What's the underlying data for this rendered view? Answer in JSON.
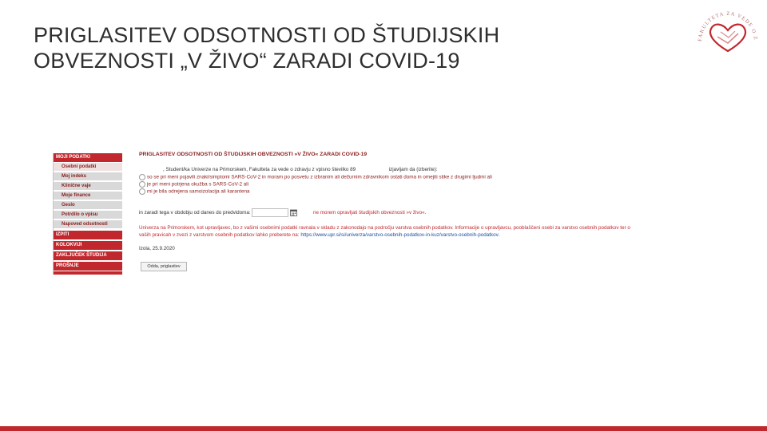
{
  "slide": {
    "title_line1": "PRIGLASITEV ODSOTNOSTI OD ŠTUDIJSKIH",
    "title_line2": "OBVEZNOSTI „V ŽIVO“ ZARADI COVID-19"
  },
  "logo": {
    "text": "FAKULTETA ZA VEDE O ZDRAVJU"
  },
  "colors": {
    "accent": "#c0282d",
    "sidebar_sub": "#d9d9d9",
    "link": "#1a4fa0"
  },
  "sidebar": {
    "items": [
      {
        "label": "MOJI PODATKI",
        "kind": "head"
      },
      {
        "label": "Osebni podatki",
        "kind": "sub"
      },
      {
        "label": "Moj indeks",
        "kind": "sub"
      },
      {
        "label": "Klinične vaje",
        "kind": "sub"
      },
      {
        "label": "Moje finance",
        "kind": "sub"
      },
      {
        "label": "Geslo",
        "kind": "sub"
      },
      {
        "label": "Potrdilo o vpisu",
        "kind": "sub"
      },
      {
        "label": "Napoved odsotnosti",
        "kind": "sub"
      },
      {
        "label": "IZPITI",
        "kind": "head"
      },
      {
        "label": "KOLOKVIJI",
        "kind": "head"
      },
      {
        "label": "ZAKLJUČEK ŠTUDIJA",
        "kind": "head"
      },
      {
        "label": "PROŠNJE",
        "kind": "head"
      }
    ]
  },
  "form": {
    "title": "PRIGLASITEV ODSOTNOSTI OD ŠTUDIJSKIH OBVEZNOSTI »V ŽIVO« ZARADI COVID-19",
    "intro_a": ", Student/ka Univerze na Primorskem, Fakulteta za vede o zdravju z vpisno številko 89",
    "intro_b": "izjavljam da (izberite):",
    "options": [
      "so se pri meni pojavili znaki/simptomi SARS-CoV-2 in moram po posvetu z izbranim ali dežurnim zdravnikom ostati doma in omejiti stike z drugimi ljudmi ali",
      "je pri meni potrjena okužba s SARS-CoV-2 ali",
      "mi je bila odrejena samoizolacija ali karantena"
    ],
    "period_a": "in zaradi tega v obdobju od danes do predvidoma:",
    "period_b": "ne morem opravljati študijskih obveznosti »v živo«.",
    "privacy_line1": "Univerza na Primorskem, kot upravljavec, bo z vašimi osebnimi podatki ravnala v skladu z zakonodajo na področju varstva osebnih podatkov. Informacije o upravljavcu, pooblaščeni osebi za varstvo osebnih podatkov ter o",
    "privacy_line2_a": "vaših pravicah v zvezi z varstvom osebnih podatkov lahko preberete na:",
    "privacy_link": "https://www.upr.si/si/univerza/varstvo-osebnih-podatkov-in-kuz/varstvo-osebnih-podatkov",
    "privacy_line2_b": ".",
    "place_date": "Izola, 25.9.2020",
    "submit_label": "Odda, priglasitev"
  }
}
